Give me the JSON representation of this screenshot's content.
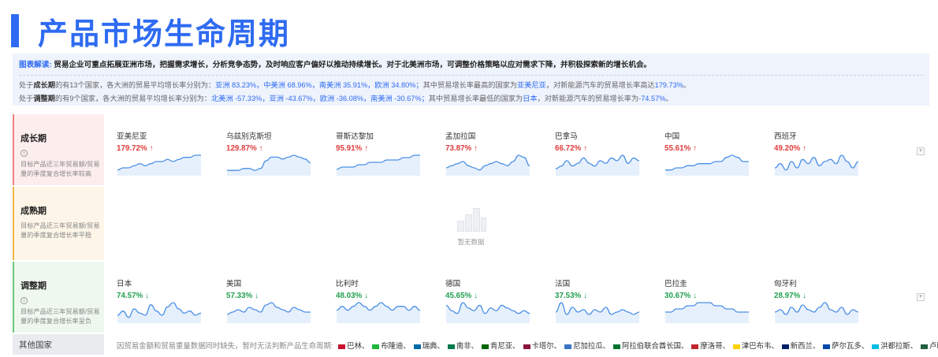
{
  "page": {
    "title": "产品市场生命周期"
  },
  "info": {
    "label": "图表解读:",
    "summary": "贸易企业可重点拓展亚洲市场，把握需求增长，分析竞争态势，及时响应客户偏好以推动持续增长。对于北美洲市场，可调整价格策略以应对需求下降，并积极探索新的增长机会。",
    "growth_line": {
      "p1": "处于",
      "stage": "成长期",
      "p2": "的有13个国家，各大洲的贸易平均增长率分别为：",
      "continents": "亚洲 83.23%，中美洲 68.96%，南美洲 35.91%，欧洲 34.80%；",
      "p3": "其中贸易增长率最高的国家为",
      "country": "亚美尼亚",
      "p4": "，对新能源汽车的贸易增长率高达",
      "value": "179.73%",
      "p5": "。"
    },
    "adjust_line": {
      "p1": "处于",
      "stage": "调整期",
      "p2": "的有9个国家，各大洲的贸易平均增长率分别为：",
      "continents": "北美洲 -57.33%，亚洲 -43.67%，欧洲 -36.08%，南美洲 -30.67%；",
      "p3": "其中贸易增长率最低的国家为",
      "country": "日本",
      "p4": "，对新能源汽车的贸易增长率为",
      "value": "-74.57%",
      "p5": "。"
    }
  },
  "sections": {
    "growth": {
      "name": "成长期",
      "desc": "目标产品近三年贸易额/贸易量的季度复合增长率较高",
      "cards": [
        {
          "country": "亚美尼亚",
          "rate": "179.72%",
          "trend": [
            2,
            3,
            3,
            4,
            5,
            4,
            5,
            6,
            6,
            7,
            6,
            7,
            8,
            8,
            9,
            9
          ]
        },
        {
          "country": "乌兹别克斯坦",
          "rate": "129.87%",
          "trend": [
            2,
            2,
            2,
            3,
            3,
            2,
            3,
            7,
            9,
            9,
            8,
            9,
            10,
            9,
            8,
            6
          ]
        },
        {
          "country": "哥斯达黎加",
          "rate": "95.91%",
          "trend": [
            2,
            3,
            3,
            3,
            4,
            4,
            5,
            5,
            5,
            6,
            6,
            6,
            7,
            7,
            8,
            8
          ]
        },
        {
          "country": "孟加拉国",
          "rate": "73.87%",
          "trend": [
            3,
            4,
            5,
            6,
            4,
            3,
            2,
            4,
            5,
            6,
            5,
            4,
            6,
            9,
            8,
            4
          ]
        },
        {
          "country": "巴拿马",
          "rate": "66.72%",
          "trend": [
            2,
            3,
            5,
            3,
            4,
            6,
            4,
            3,
            5,
            4,
            6,
            5,
            7,
            4,
            6,
            5
          ]
        },
        {
          "country": "中国",
          "rate": "55.61%",
          "trend": [
            2,
            2,
            3,
            3,
            4,
            4,
            5,
            5,
            5,
            6,
            6,
            8,
            9,
            8,
            6,
            6
          ]
        },
        {
          "country": "西班牙",
          "rate": "49.20%",
          "trend": [
            3,
            5,
            2,
            6,
            3,
            7,
            5,
            8,
            4,
            6,
            7,
            5,
            9,
            6,
            3,
            6
          ]
        }
      ]
    },
    "mature": {
      "name": "成熟期",
      "desc": "目标产品近三年贸易额/贸易量的季度复合增长率平稳",
      "empty": "暂无数据"
    },
    "adjust": {
      "name": "调整期",
      "desc": "目标产品近三年贸易额/贸易量的季度复合增长率呈负",
      "cards": [
        {
          "country": "日本",
          "rate": "74.57%",
          "trend": [
            3,
            5,
            2,
            6,
            4,
            3,
            8,
            5,
            3,
            7,
            9,
            6,
            4,
            5,
            3,
            4
          ]
        },
        {
          "country": "美国",
          "rate": "57.33%",
          "trend": [
            3,
            4,
            5,
            4,
            6,
            5,
            4,
            7,
            8,
            6,
            5,
            4,
            6,
            5,
            4,
            4
          ]
        },
        {
          "country": "比利时",
          "rate": "48.03%",
          "trend": [
            3,
            4,
            3,
            4,
            5,
            4,
            3,
            4,
            5,
            4,
            3,
            4,
            4,
            3,
            4,
            3
          ]
        },
        {
          "country": "德国",
          "rate": "45.65%",
          "trend": [
            6,
            4,
            3,
            7,
            5,
            4,
            6,
            3,
            5,
            4,
            6,
            5,
            4,
            3,
            4,
            3
          ]
        },
        {
          "country": "法国",
          "rate": "37.53%",
          "trend": [
            4,
            8,
            3,
            6,
            4,
            5,
            3,
            5,
            4,
            6,
            3,
            4,
            5,
            4,
            3,
            4
          ]
        },
        {
          "country": "巴拉圭",
          "rate": "30.67%",
          "trend": [
            3,
            3,
            4,
            4,
            5,
            5,
            6,
            6,
            6,
            5,
            5,
            4,
            4,
            3,
            3,
            3
          ]
        },
        {
          "country": "匈牙利",
          "rate": "28.97%",
          "trend": [
            4,
            5,
            3,
            6,
            4,
            7,
            5,
            4,
            6,
            8,
            5,
            4,
            6,
            3,
            5,
            4
          ]
        }
      ]
    },
    "other": {
      "name": "其他国家",
      "text": "因贸易金额和贸易重量数据同时缺失，暂时无法判断产品生命周期:",
      "countries": [
        {
          "name": "巴林、",
          "color": "#c8102e"
        },
        {
          "name": "布隆迪、",
          "color": "#1eb53a"
        },
        {
          "name": "瑞典、",
          "color": "#006aa7"
        },
        {
          "name": "南非、",
          "color": "#007a4d"
        },
        {
          "name": "肯尼亚、",
          "color": "#006600"
        },
        {
          "name": "卡塔尔、",
          "color": "#8a1538"
        },
        {
          "name": "尼加拉瓜、",
          "color": "#3a75c4"
        },
        {
          "name": "阿拉伯联合酋长国、",
          "color": "#00732f"
        },
        {
          "name": "摩洛哥、",
          "color": "#c1272d"
        },
        {
          "name": "津巴布韦、",
          "color": "#ffd200"
        },
        {
          "name": "新西兰、",
          "color": "#012169"
        },
        {
          "name": "萨尔瓦多、",
          "color": "#0047ab"
        },
        {
          "name": "洪都拉斯、",
          "color": "#00bce4"
        },
        {
          "name": "卢旺达、",
          "color": "#20603d"
        }
      ]
    }
  },
  "colors": {
    "accent": "#2f6bf2",
    "up": "#e03c3c",
    "down": "#22a050",
    "spark": "#4b8fe6"
  }
}
